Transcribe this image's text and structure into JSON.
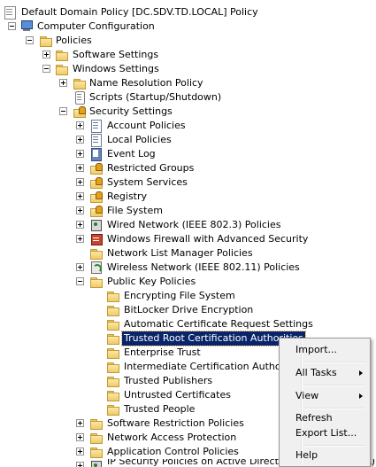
{
  "tree": {
    "items": [
      {
        "label": "Default Domain Policy [DC.SDV.TD.LOCAL] Policy",
        "icon": "gpo-icon"
      },
      {
        "label": "Computer Configuration",
        "icon": "computer-icon"
      },
      {
        "label": "Policies",
        "icon": "folder-icon"
      },
      {
        "label": "Software Settings",
        "icon": "folder-icon"
      },
      {
        "label": "Windows Settings",
        "icon": "folder-icon"
      },
      {
        "label": "Name Resolution Policy",
        "icon": "folder-icon"
      },
      {
        "label": "Scripts (Startup/Shutdown)",
        "icon": "scroll-icon"
      },
      {
        "label": "Security Settings",
        "icon": "lock-folder-icon"
      },
      {
        "label": "Account Policies",
        "icon": "policy-icon"
      },
      {
        "label": "Local Policies",
        "icon": "policy-icon"
      },
      {
        "label": "Event Log",
        "icon": "book-icon"
      },
      {
        "label": "Restricted Groups",
        "icon": "lock-folder-icon"
      },
      {
        "label": "System Services",
        "icon": "lock-folder-icon"
      },
      {
        "label": "Registry",
        "icon": "lock-folder-icon"
      },
      {
        "label": "File System",
        "icon": "lock-folder-icon"
      },
      {
        "label": "Wired Network (IEEE 802.3) Policies",
        "icon": "network-icon"
      },
      {
        "label": "Windows Firewall with Advanced Security",
        "icon": "firewall-icon"
      },
      {
        "label": "Network List Manager Policies",
        "icon": "folder-icon"
      },
      {
        "label": "Wireless Network (IEEE 802.11) Policies",
        "icon": "wifi-icon"
      },
      {
        "label": "Public Key Policies",
        "icon": "folder-icon"
      },
      {
        "label": "Encrypting File System",
        "icon": "folder-icon"
      },
      {
        "label": "BitLocker Drive Encryption",
        "icon": "folder-icon"
      },
      {
        "label": "Automatic Certificate Request Settings",
        "icon": "folder-icon"
      },
      {
        "label": "Trusted Root Certification Authorities",
        "icon": "folder-icon",
        "selected": true
      },
      {
        "label": "Enterprise Trust",
        "icon": "folder-icon"
      },
      {
        "label": "Intermediate Certification Authorities",
        "icon": "folder-icon"
      },
      {
        "label": "Trusted Publishers",
        "icon": "folder-icon"
      },
      {
        "label": "Untrusted Certificates",
        "icon": "folder-icon"
      },
      {
        "label": "Trusted People",
        "icon": "folder-icon"
      },
      {
        "label": "Software Restriction Policies",
        "icon": "folder-icon"
      },
      {
        "label": "Network Access Protection",
        "icon": "folder-icon"
      },
      {
        "label": "Application Control Policies",
        "icon": "folder-icon"
      },
      {
        "label": "IP Security Policies on Active Directory (SDV.TD.LOCAL)",
        "icon": "network-icon"
      }
    ]
  },
  "context_menu": {
    "items": [
      {
        "label": "Import..."
      },
      {
        "label": "All Tasks",
        "submenu": true
      },
      {
        "label": "View",
        "submenu": true
      },
      {
        "label": "Refresh"
      },
      {
        "label": "Export List..."
      },
      {
        "label": "Help"
      }
    ]
  },
  "colors": {
    "selection_bg": "#0a246a",
    "selection_text": "#ffffff",
    "menu_bg": "#f0f0f0"
  }
}
